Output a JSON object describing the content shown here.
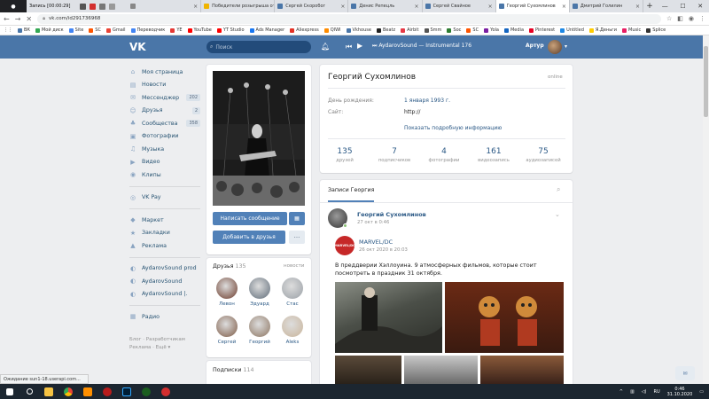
{
  "recorder": {
    "title": "Запись [00:00:29]"
  },
  "tabs": [
    {
      "label": "",
      "color": "#888"
    },
    {
      "label": "Победители розыгрыша от c",
      "color": "#f0b400"
    },
    {
      "label": "Сергей Скоробог",
      "color": "#4a76a8"
    },
    {
      "label": "Денис Репецль",
      "color": "#4a76a8"
    },
    {
      "label": "Сергей Свайное",
      "color": "#4a76a8"
    },
    {
      "label": "Георгий Сухомлинов",
      "color": "#4a76a8",
      "active": true
    },
    {
      "label": "Дмитрий Голилин",
      "color": "#4a76a8"
    }
  ],
  "address": {
    "url": "vk.com/id291736968"
  },
  "bookmarks": [
    {
      "label": "ВК",
      "color": "#4a76a8"
    },
    {
      "label": "Мой диск",
      "color": "#34a853"
    },
    {
      "label": "Site",
      "color": "#4285f4"
    },
    {
      "label": "SC",
      "color": "#ff5500"
    },
    {
      "label": "Gmail",
      "color": "#ea4335"
    },
    {
      "label": "Переводчик",
      "color": "#4285f4"
    },
    {
      "label": "YE",
      "color": "#e53935"
    },
    {
      "label": "YouTube",
      "color": "#ff0000"
    },
    {
      "label": "YT Studio",
      "color": "#ff0000"
    },
    {
      "label": "Ads Manager",
      "color": "#1877f2"
    },
    {
      "label": "Aliexpress",
      "color": "#e43225"
    },
    {
      "label": "QIWI",
      "color": "#ff8c00"
    },
    {
      "label": "Vkhouse",
      "color": "#4a76a8"
    },
    {
      "label": "Beatz",
      "color": "#222"
    },
    {
      "label": "Airbit",
      "color": "#e63946"
    },
    {
      "label": "Smm",
      "color": "#555"
    },
    {
      "label": "Soc",
      "color": "#2e7d32"
    },
    {
      "label": "SC",
      "color": "#ff5500"
    },
    {
      "label": "Yola",
      "color": "#7b1fa2"
    },
    {
      "label": "Media",
      "color": "#1565c0"
    },
    {
      "label": "Pinterest",
      "color": "#e60023"
    },
    {
      "label": "Untitled",
      "color": "#1e88e5"
    },
    {
      "label": "Я.Деньги",
      "color": "#ffcc00"
    },
    {
      "label": "Music",
      "color": "#e91e63"
    },
    {
      "label": "Splice",
      "color": "#333"
    }
  ],
  "header": {
    "search_placeholder": "Поиск",
    "player_track": "AydarovSound — Instrumental 176",
    "user_name": "Артур"
  },
  "menu": {
    "items": [
      {
        "label": "Моя страница",
        "icon": "⌂",
        "count": ""
      },
      {
        "label": "Новости",
        "icon": "▤",
        "count": ""
      },
      {
        "label": "Мессенджер",
        "icon": "✉",
        "count": "202"
      },
      {
        "label": "Друзья",
        "icon": "☺",
        "count": "2"
      },
      {
        "label": "Сообщества",
        "icon": "♣",
        "count": "358"
      },
      {
        "label": "Фотографии",
        "icon": "▣",
        "count": ""
      },
      {
        "label": "Музыка",
        "icon": "♫",
        "count": ""
      },
      {
        "label": "Видео",
        "icon": "▶",
        "count": ""
      },
      {
        "label": "Клипы",
        "icon": "◉",
        "count": ""
      }
    ],
    "items2": [
      {
        "label": "VK Pay",
        "icon": "◎"
      }
    ],
    "items3": [
      {
        "label": "Маркет",
        "icon": "◆"
      },
      {
        "label": "Закладки",
        "icon": "★"
      },
      {
        "label": "Реклама",
        "icon": "▲"
      }
    ],
    "items4": [
      {
        "label": "AydarovSound prod",
        "icon": "◐"
      },
      {
        "label": "AydarovSound",
        "icon": "◐"
      },
      {
        "label": "AydarovSound |.",
        "icon": "◐"
      }
    ],
    "items5": [
      {
        "label": "Радио",
        "icon": "▦"
      }
    ],
    "footer_line1": "Блог · Разработчикам",
    "footer_line2": "Реклама · Ещё ▾"
  },
  "profile": {
    "name": "Георгий Сухомлинов",
    "status": "online",
    "birthday_label": "День рождения:",
    "birthday_value": "1 января 1993 г.",
    "site_label": "Сайт:",
    "site_value": "http://",
    "more_info": "Показать подробную информацию",
    "stats": [
      {
        "n": "135",
        "t": "друзей"
      },
      {
        "n": "7",
        "t": "подписчиков"
      },
      {
        "n": "4",
        "t": "фотографии"
      },
      {
        "n": "161",
        "t": "видеозапись"
      },
      {
        "n": "75",
        "t": "аудиозаписей"
      }
    ]
  },
  "actions": {
    "message": "Написать сообщение",
    "add_friend": "Добавить в друзья",
    "more": "···"
  },
  "friends": {
    "title": "Друзья",
    "count": "135",
    "link": "новости",
    "list": [
      {
        "name": "Левон",
        "color": "#6b3a2a"
      },
      {
        "name": "Эдуард",
        "color": "#5e6b78"
      },
      {
        "name": "Стас",
        "color": "#9aa0a6"
      },
      {
        "name": "Сергей",
        "color": "#7d5a45"
      },
      {
        "name": "Георгий",
        "color": "#8c7460"
      },
      {
        "name": "Aleks",
        "color": "#c9b49a"
      }
    ]
  },
  "subscriptions": {
    "title": "Подписки",
    "count": "114"
  },
  "wall": {
    "tab": "Записи Георгия",
    "author": "Георгий Сухомлинов",
    "author_date": "27 окт в 0:46",
    "repost_name": "MARVEL/DC",
    "repost_date": "26 окт 2020 в 20:03",
    "repost_logo": "MARVEL/DC",
    "text": "В преддверии Хэллоуина. 9 атмосферных фильмов, которые стоит посмотреть в праздник 31 октября."
  },
  "status_bar": "Ожидание sun1-18.userapi.com...",
  "taskbar": {
    "lang": "RU",
    "time": "0:46",
    "date": "31.10.2020"
  }
}
